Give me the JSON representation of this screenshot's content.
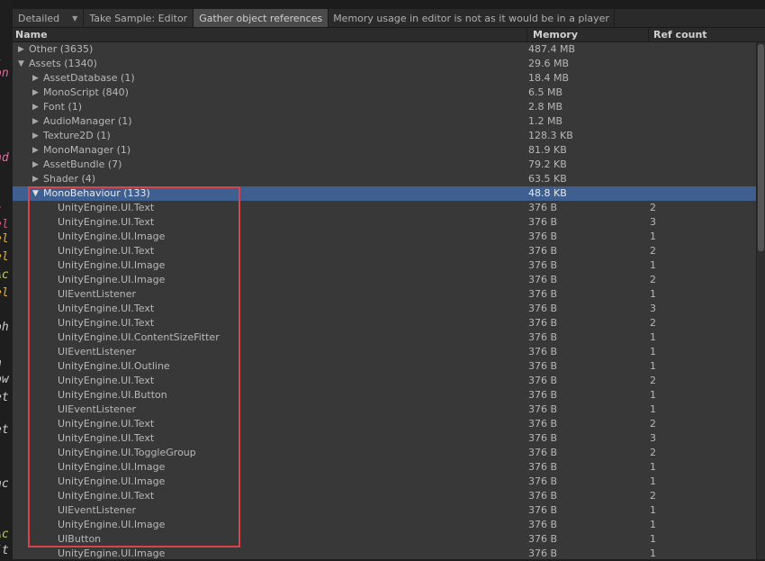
{
  "toolbar": {
    "detailed_label": "Detailed",
    "take_sample_label": "Take Sample: Editor",
    "gather_label": "Gather object references",
    "note": "Memory usage in editor is not as it would be in a player"
  },
  "columns": {
    "name": "Name",
    "memory": "Memory",
    "ref_count": "Ref count"
  },
  "rows": [
    {
      "name": "Other (3635)",
      "memory": "487.4 MB",
      "ref": "",
      "level": 0,
      "arrow": "▶"
    },
    {
      "name": "Assets (1340)",
      "memory": "29.6 MB",
      "ref": "",
      "level": 0,
      "arrow": "▼"
    },
    {
      "name": "AssetDatabase (1)",
      "memory": "18.4 MB",
      "ref": "",
      "level": 1,
      "arrow": "▶"
    },
    {
      "name": "MonoScript (840)",
      "memory": "6.5 MB",
      "ref": "",
      "level": 1,
      "arrow": "▶"
    },
    {
      "name": "Font (1)",
      "memory": "2.8 MB",
      "ref": "",
      "level": 1,
      "arrow": "▶"
    },
    {
      "name": "AudioManager (1)",
      "memory": "1.2 MB",
      "ref": "",
      "level": 1,
      "arrow": "▶"
    },
    {
      "name": "Texture2D (1)",
      "memory": "128.3 KB",
      "ref": "",
      "level": 1,
      "arrow": "▶"
    },
    {
      "name": "MonoManager (1)",
      "memory": "81.9 KB",
      "ref": "",
      "level": 1,
      "arrow": "▶"
    },
    {
      "name": "AssetBundle (7)",
      "memory": "79.2 KB",
      "ref": "",
      "level": 1,
      "arrow": "▶"
    },
    {
      "name": "Shader (4)",
      "memory": "63.5 KB",
      "ref": "",
      "level": 1,
      "arrow": "▶"
    },
    {
      "name": "MonoBehaviour (133)",
      "memory": "48.8 KB",
      "ref": "",
      "level": 1,
      "arrow": "▼",
      "selected": true
    },
    {
      "name": "UnityEngine.UI.Text",
      "memory": "376 B",
      "ref": "2",
      "level": 2
    },
    {
      "name": "UnityEngine.UI.Text",
      "memory": "376 B",
      "ref": "3",
      "level": 2
    },
    {
      "name": "UnityEngine.UI.Image",
      "memory": "376 B",
      "ref": "1",
      "level": 2
    },
    {
      "name": "UnityEngine.UI.Text",
      "memory": "376 B",
      "ref": "2",
      "level": 2
    },
    {
      "name": "UnityEngine.UI.Image",
      "memory": "376 B",
      "ref": "1",
      "level": 2
    },
    {
      "name": "UnityEngine.UI.Image",
      "memory": "376 B",
      "ref": "2",
      "level": 2
    },
    {
      "name": "UIEventListener",
      "memory": "376 B",
      "ref": "1",
      "level": 2
    },
    {
      "name": "UnityEngine.UI.Text",
      "memory": "376 B",
      "ref": "3",
      "level": 2
    },
    {
      "name": "UnityEngine.UI.Text",
      "memory": "376 B",
      "ref": "2",
      "level": 2
    },
    {
      "name": "UnityEngine.UI.ContentSizeFitter",
      "memory": "376 B",
      "ref": "1",
      "level": 2
    },
    {
      "name": "UIEventListener",
      "memory": "376 B",
      "ref": "1",
      "level": 2
    },
    {
      "name": "UnityEngine.UI.Outline",
      "memory": "376 B",
      "ref": "1",
      "level": 2
    },
    {
      "name": "UnityEngine.UI.Text",
      "memory": "376 B",
      "ref": "2",
      "level": 2
    },
    {
      "name": "UnityEngine.UI.Button",
      "memory": "376 B",
      "ref": "1",
      "level": 2
    },
    {
      "name": "UIEventListener",
      "memory": "376 B",
      "ref": "1",
      "level": 2
    },
    {
      "name": "UnityEngine.UI.Text",
      "memory": "376 B",
      "ref": "2",
      "level": 2
    },
    {
      "name": "UnityEngine.UI.Text",
      "memory": "376 B",
      "ref": "3",
      "level": 2
    },
    {
      "name": "UnityEngine.UI.ToggleGroup",
      "memory": "376 B",
      "ref": "2",
      "level": 2
    },
    {
      "name": "UnityEngine.UI.Image",
      "memory": "376 B",
      "ref": "1",
      "level": 2
    },
    {
      "name": "UnityEngine.UI.Image",
      "memory": "376 B",
      "ref": "1",
      "level": 2
    },
    {
      "name": "UnityEngine.UI.Text",
      "memory": "376 B",
      "ref": "2",
      "level": 2
    },
    {
      "name": "UIEventListener",
      "memory": "376 B",
      "ref": "1",
      "level": 2
    },
    {
      "name": "UnityEngine.UI.Image",
      "memory": "376 B",
      "ref": "1",
      "level": 2
    },
    {
      "name": "UIButton",
      "memory": "376 B",
      "ref": "1",
      "level": 2
    },
    {
      "name": "UnityEngine.UI.Image",
      "memory": "376 B",
      "ref": "1",
      "level": 2
    }
  ],
  "gutter_chars": [
    {
      "text": "i",
      "color": "#d0d0d0"
    },
    {
      "text": "on",
      "color": "#e06c9f"
    },
    {
      "text": "nd",
      "color": "#e06c9f"
    },
    {
      "text": "t",
      "color": "#e0507a"
    },
    {
      "text": "el",
      "color": "#e0507a"
    },
    {
      "text": "el",
      "color": "#e8b020"
    },
    {
      "text": "el",
      "color": "#e8b020"
    },
    {
      "text": "Ac",
      "color": "#c8d060"
    },
    {
      "text": "el",
      "color": "#e8b020"
    },
    {
      "text": "oh",
      "color": "#d0d0d0"
    },
    {
      "text": "n",
      "color": "#d0d0d0"
    },
    {
      "text": "ow",
      "color": "#d0d0d0"
    },
    {
      "text": "et",
      "color": "#d0d0d0"
    },
    {
      "text": "et",
      "color": "#d0d0d0"
    },
    {
      "text": "nc",
      "color": "#d0d0d0"
    },
    {
      "text": "Ac",
      "color": "#b0d060"
    },
    {
      "text": "(t",
      "color": "#d0d0d0"
    }
  ],
  "colors": {
    "selection": "#3e5f8f",
    "highlight_box": "#d9434a"
  }
}
